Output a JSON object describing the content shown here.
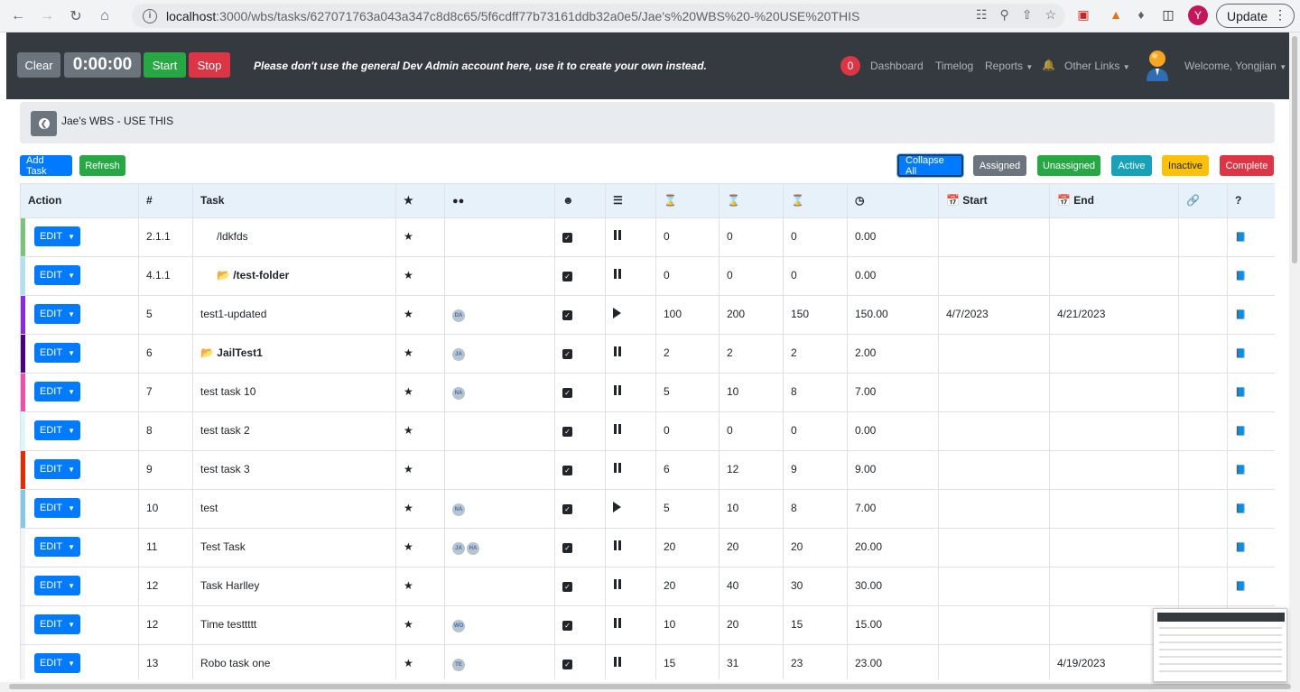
{
  "browser": {
    "url_host": "localhost",
    "url_path": ":3000/wbs/tasks/627071763a043a347c8d8c65/5f6cdff77b73161ddb32a0e5/Jae's%20WBS%20-%20USE%20THIS",
    "profile_initial": "Y",
    "update_label": "Update"
  },
  "header": {
    "clear_label": "Clear",
    "timer": "0:00:00",
    "start_label": "Start",
    "stop_label": "Stop",
    "warning": "Please don't use the general Dev Admin account here, use it to create your own instead.",
    "notification_count": "0",
    "nav": {
      "dashboard": "Dashboard",
      "timelog": "Timelog",
      "reports": "Reports",
      "other_links": "Other Links",
      "welcome": "Welcome, Yongjian"
    }
  },
  "breadcrumb": {
    "title": "Jae's WBS - USE THIS"
  },
  "toolbar": {
    "add_task": "Add Task",
    "refresh": "Refresh",
    "collapse_all": "Collapse All",
    "assigned": "Assigned",
    "unassigned": "Unassigned",
    "active": "Active",
    "inactive": "Inactive",
    "complete": "Complete"
  },
  "table": {
    "headers": {
      "action": "Action",
      "num": "#",
      "task": "Task",
      "start": "Start",
      "end": "End",
      "help": "?"
    },
    "edit_label": "EDIT",
    "rows": [
      {
        "num": "2.1.1",
        "task": "/ldkfds",
        "indent": true,
        "folder": false,
        "bold": false,
        "chips": [],
        "status": "pause",
        "a": "0",
        "b": "0",
        "c": "0",
        "d": "0.00",
        "start": "",
        "end": "",
        "stripe": "#7bc27b"
      },
      {
        "num": "4.1.1",
        "task": "/test-folder",
        "indent": true,
        "folder": true,
        "bold": true,
        "chips": [],
        "status": "pause",
        "a": "0",
        "b": "0",
        "c": "0",
        "d": "0.00",
        "start": "",
        "end": "",
        "stripe": "#b3dff0"
      },
      {
        "num": "5",
        "task": "test1-updated",
        "indent": false,
        "folder": false,
        "bold": false,
        "chips": [
          "DA"
        ],
        "status": "play",
        "a": "100",
        "b": "200",
        "c": "150",
        "d": "150.00",
        "start": "4/7/2023",
        "end": "4/21/2023",
        "stripe": "#8a2be2"
      },
      {
        "num": "6",
        "task": "JailTest1",
        "indent": false,
        "folder": true,
        "bold": true,
        "chips": [
          "JA"
        ],
        "status": "pause",
        "a": "2",
        "b": "2",
        "c": "2",
        "d": "2.00",
        "start": "",
        "end": "",
        "stripe": "#4b0082"
      },
      {
        "num": "7",
        "task": "test task 10",
        "indent": false,
        "folder": false,
        "bold": false,
        "chips": [
          "NA"
        ],
        "status": "pause",
        "a": "5",
        "b": "10",
        "c": "8",
        "d": "7.00",
        "start": "",
        "end": "",
        "stripe": "#ee4fa8"
      },
      {
        "num": "8",
        "task": "test task 2",
        "indent": false,
        "folder": false,
        "bold": false,
        "chips": [],
        "status": "pause",
        "a": "0",
        "b": "0",
        "c": "0",
        "d": "0.00",
        "start": "",
        "end": "",
        "stripe": "#e0f7fa"
      },
      {
        "num": "9",
        "task": "test task 3",
        "indent": false,
        "folder": false,
        "bold": false,
        "chips": [],
        "status": "pause",
        "a": "6",
        "b": "12",
        "c": "9",
        "d": "9.00",
        "start": "",
        "end": "",
        "stripe": "#e52b00"
      },
      {
        "num": "10",
        "task": "test",
        "indent": false,
        "folder": false,
        "bold": false,
        "chips": [
          "NA"
        ],
        "status": "play",
        "a": "5",
        "b": "10",
        "c": "8",
        "d": "7.00",
        "start": "",
        "end": "",
        "stripe": "#87c7e3"
      },
      {
        "num": "11",
        "task": "Test Task",
        "indent": false,
        "folder": false,
        "bold": false,
        "chips": [
          "JA",
          "HA"
        ],
        "status": "pause",
        "a": "20",
        "b": "20",
        "c": "20",
        "d": "20.00",
        "start": "",
        "end": "",
        "stripe": "#f5f5f5"
      },
      {
        "num": "12",
        "task": "Task Harlley",
        "indent": false,
        "folder": false,
        "bold": false,
        "chips": [],
        "status": "pause",
        "a": "20",
        "b": "40",
        "c": "30",
        "d": "30.00",
        "start": "",
        "end": "",
        "stripe": "#f5f5f5"
      },
      {
        "num": "12",
        "task": "Time testtttt",
        "indent": false,
        "folder": false,
        "bold": false,
        "chips": [
          "WO"
        ],
        "status": "pause",
        "a": "10",
        "b": "20",
        "c": "15",
        "d": "15.00",
        "start": "",
        "end": "",
        "stripe": "#f5f5f5"
      },
      {
        "num": "13",
        "task": "Robo task one",
        "indent": false,
        "folder": false,
        "bold": false,
        "chips": [
          "TE"
        ],
        "status": "pause",
        "a": "15",
        "b": "31",
        "c": "23",
        "d": "23.00",
        "start": "",
        "end": "4/19/2023",
        "stripe": "#f5f5f5"
      }
    ]
  },
  "colors": {
    "primary": "#007bff",
    "success": "#28a745",
    "danger": "#dc3545",
    "secondary": "#6c757d",
    "info": "#17a2b8",
    "warning": "#ffc107",
    "dark": "#343a40"
  }
}
